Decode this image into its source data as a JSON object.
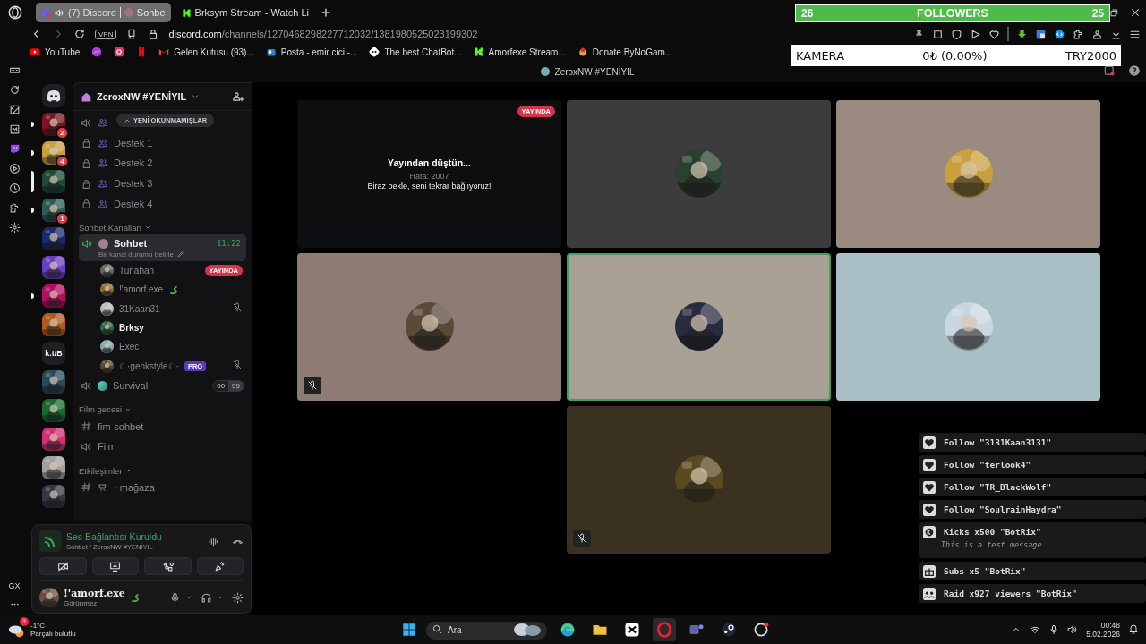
{
  "browser": {
    "tabs": [
      {
        "title": "(7) Discord",
        "subtitle": "Sohbe",
        "selected": true
      },
      {
        "title": "Brksym Stream - Watch Li",
        "selected": false
      }
    ],
    "vpn": "VPN",
    "domain": "discord.com",
    "path": "/channels/1270468298227712032/1381980525023199302",
    "bookmarks": [
      {
        "kind": "youtube",
        "label": "YouTube"
      },
      {
        "kind": "messenger"
      },
      {
        "kind": "instagram"
      },
      {
        "kind": "netflix"
      },
      {
        "kind": "gmail",
        "label": "Gelen Kutusu (93)..."
      },
      {
        "kind": "outlook",
        "label": "Posta - emir cici -..."
      },
      {
        "kind": "bot",
        "label": "The best ChatBot..."
      },
      {
        "kind": "kick",
        "label": "Amorfexe Stream..."
      },
      {
        "kind": "donate",
        "label": "Donate ByNoGam..."
      }
    ]
  },
  "followers_goal": {
    "current": "26",
    "label": "FOLLOWERS",
    "target": "25",
    "level": 1
  },
  "donation_goal": {
    "label": "KAMERA",
    "amount": "0₺ (0.00%)",
    "target": "TRY2000"
  },
  "opera_sidebar": {
    "label": "GX"
  },
  "discord": {
    "title": "ZeroxNW #YENİYIL",
    "servers": [
      {
        "color": "#7a1422",
        "badge": "2",
        "unread": true,
        "selected": false
      },
      {
        "color": "#c9a040",
        "badge": "4",
        "unread": true,
        "selected": false
      },
      {
        "color": "#1f4a38",
        "unread": false,
        "selected": true
      },
      {
        "color": "#2f5a55",
        "badge": "1",
        "unread": true,
        "selected": false
      },
      {
        "color": "#1a2a6a",
        "unread": false,
        "selected": false
      },
      {
        "color": "#6a40c0",
        "unread": false,
        "selected": false
      },
      {
        "color": "#b01060",
        "unread": true,
        "selected": false
      },
      {
        "color": "#b05a20",
        "unread": false,
        "selected": false
      },
      {
        "label": "k.t/B",
        "unread": false,
        "selected": false
      },
      {
        "color": "#2a4a5a",
        "unread": false,
        "selected": false
      },
      {
        "color": "#1a6a30",
        "unread": false,
        "selected": false
      },
      {
        "color": "#d03070",
        "unread": false,
        "selected": false
      },
      {
        "color": "#a0a0a0",
        "unread": false,
        "selected": false
      },
      {
        "color": "#303840",
        "unread": false,
        "selected": false
      }
    ],
    "server_name": "ZeroxNW #YENİYIL",
    "unread_pill": "YENİ OKUNMAMIŞLAR",
    "top_channels": [
      {
        "kind": "voice"
      },
      {
        "kind": "locked",
        "name": "Destek 1"
      },
      {
        "kind": "locked",
        "name": "Destek 2"
      },
      {
        "kind": "locked",
        "name": "Destek 3"
      },
      {
        "kind": "locked",
        "name": "Destek 4"
      }
    ],
    "categories": [
      {
        "name": "Sohbet Kanalları",
        "expanded": true,
        "channels": [
          {
            "kind": "voice",
            "name": "Sohbet",
            "selected": true,
            "time": "11:22",
            "status": "Bir kanal durumu belirle",
            "children": [
              {
                "name": "Tunahan",
                "badge": "YAYINDA",
                "speaking": false,
                "muted": false
              },
              {
                "name": "!'amorf.exe",
                "speaking": false,
                "muted": false
              },
              {
                "name": "31Kaan31",
                "speaking": false,
                "muted": true
              },
              {
                "name": "Brksy",
                "speaking": true,
                "muted": false
              },
              {
                "name": "Exec",
                "speaking": false,
                "muted": false
              },
              {
                "name": "☾·genkstyle☾·",
                "tag": "PRO",
                "speaking": false,
                "muted": true
              }
            ]
          },
          {
            "kind": "voice",
            "name": "Survival",
            "selected": false,
            "count": "00",
            "limit": "99"
          }
        ]
      },
      {
        "name": "Film gecesi",
        "expanded": true,
        "channels": [
          {
            "kind": "text",
            "name": "fim-sohbet",
            "selected": false
          },
          {
            "kind": "voice",
            "name": "Film",
            "selected": false
          }
        ]
      },
      {
        "name": "Etkileşimler",
        "expanded": true,
        "channels": [
          {
            "kind": "text",
            "name": "· mağaza",
            "selected": false
          }
        ]
      }
    ],
    "voice_panel": {
      "status": "Ses Bağlantısı Kuruldu",
      "location": "Sohbet / ZeroxNW #YENİYIL"
    },
    "user": {
      "name": "!'amorf.exe",
      "status": "Görünmez"
    },
    "tiles": [
      {
        "kind": "status",
        "badge": "YAYINDA",
        "title": "Yayından düştün...",
        "error": "Hata: 2007",
        "message": "Biraz bekle, seni tekrar bağlıyoruz!"
      },
      {
        "kind": "avatar",
        "color": "#3b3c3b",
        "speaking": false,
        "muted": false
      },
      {
        "kind": "avatar",
        "color": "#9a8a7f",
        "speaking": false,
        "muted": false
      },
      {
        "kind": "avatar",
        "color": "#8e7c74",
        "speaking": false,
        "muted": true
      },
      {
        "kind": "avatar",
        "color": "#a9a294",
        "speaking": true,
        "muted": false
      },
      {
        "kind": "avatar",
        "color": "#a9bfc6",
        "speaking": false,
        "muted": false
      },
      {
        "kind": "avatar",
        "color": "#3a3120",
        "speaking": false,
        "muted": true
      }
    ]
  },
  "alerts": [
    {
      "kind": "follow",
      "text": "Follow \"3131Kaan3131\""
    },
    {
      "kind": "follow",
      "text": "Follow \"terlook4\""
    },
    {
      "kind": "follow",
      "text": "Follow \"TR_BlackWolf\""
    },
    {
      "kind": "follow",
      "text": "Follow \"SoulrainHaydra\""
    },
    {
      "kind": "kicks",
      "text": "Kicks x500 \"BotRix\"",
      "message": "This is a test message"
    },
    {
      "kind": "subs",
      "text": "Subs x5 \"BotRix\""
    },
    {
      "kind": "raid",
      "text": "Raid x927 viewers \"BotRix\""
    }
  ],
  "taskbar": {
    "weather": {
      "badge": "3",
      "temp": "-1°C",
      "desc": "Parçalı bulutlu"
    },
    "placeholder": "Ara",
    "apps": [
      {
        "kind": "edge",
        "selected": false
      },
      {
        "kind": "folder",
        "selected": false
      },
      {
        "kind": "capcut",
        "selected": false
      },
      {
        "kind": "opera",
        "selected": true
      },
      {
        "kind": "teams",
        "selected": false
      },
      {
        "kind": "steam",
        "selected": false
      },
      {
        "kind": "game",
        "selected": false
      }
    ],
    "time": "00:48",
    "date": "5.02.2026"
  }
}
